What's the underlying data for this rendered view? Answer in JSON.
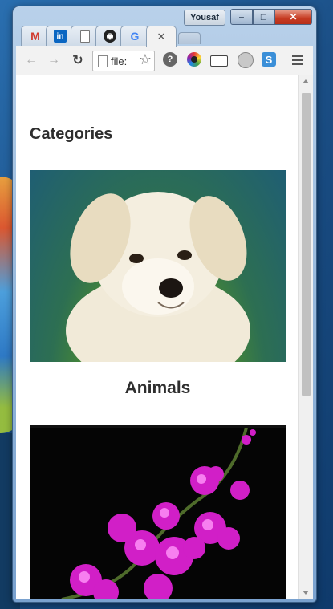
{
  "window": {
    "user_name": "Yousaf",
    "controls": {
      "minimize": "–",
      "maximize": "□",
      "close": "✕"
    }
  },
  "tabs": [
    {
      "favicon": "gmail-icon",
      "glyph": "M"
    },
    {
      "favicon": "linkedin-icon",
      "glyph": "in"
    },
    {
      "favicon": "document-icon",
      "glyph": ""
    },
    {
      "favicon": "github-icon",
      "glyph": "◉"
    },
    {
      "favicon": "google-icon",
      "glyph": "G"
    },
    {
      "favicon": "blank-icon",
      "glyph": "",
      "close": "✕",
      "active": true
    }
  ],
  "toolbar": {
    "back": "←",
    "forward": "→",
    "reload": "↻",
    "address": "file:",
    "star": "☆",
    "extensions": {
      "help": "?",
      "sync": "S"
    }
  },
  "page": {
    "heading": "Categories",
    "categories": [
      {
        "name": "Animals",
        "image": "puppy"
      },
      {
        "name": "",
        "image": "orchid"
      }
    ]
  }
}
